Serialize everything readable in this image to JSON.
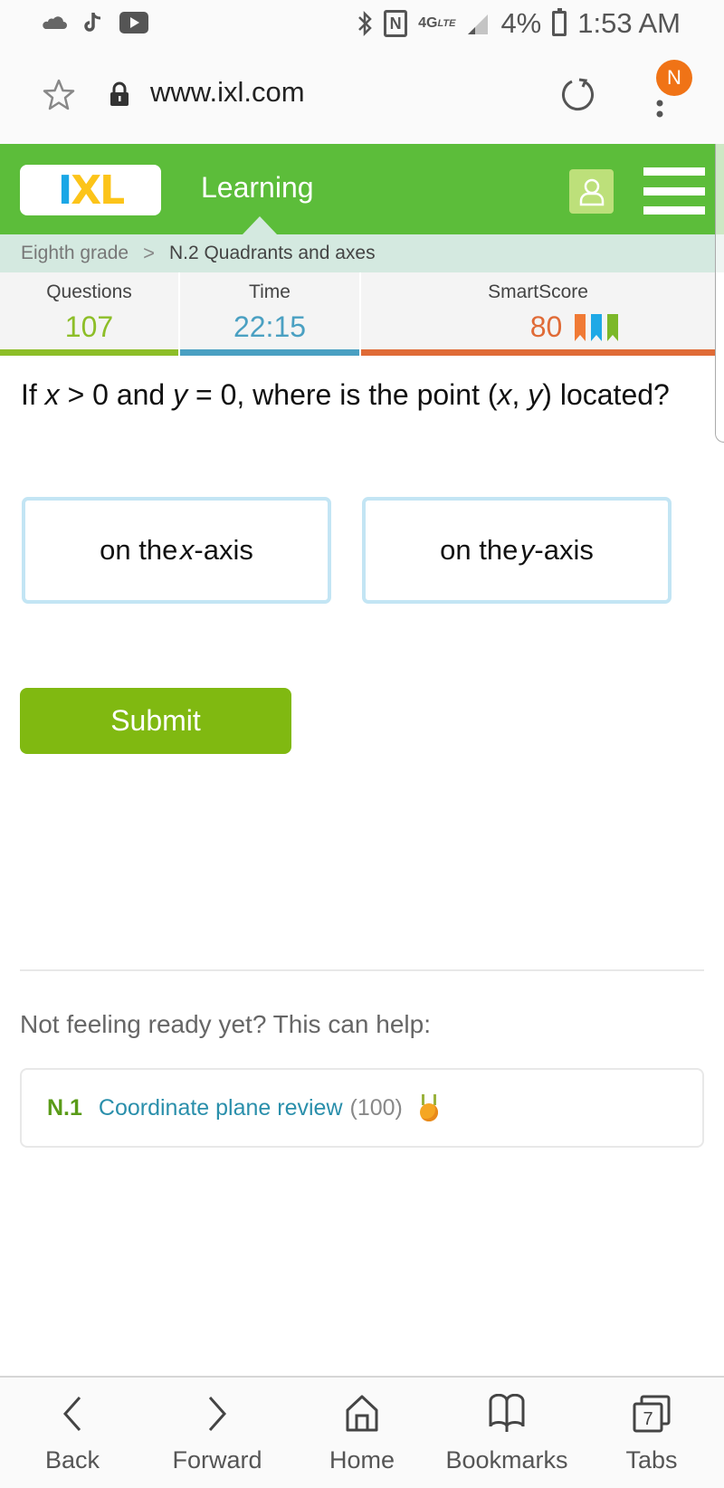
{
  "status_bar": {
    "left_icons": [
      "cloud-icon",
      "tiktok-icon",
      "youtube-icon"
    ],
    "right_icons": [
      "bluetooth-icon",
      "nfc-icon",
      "4g-lte-icon",
      "signal-icon"
    ],
    "network": "4G",
    "network_sub": "LTE",
    "nfc_label": "N",
    "battery": "4%",
    "time": "1:53 AM"
  },
  "browser": {
    "url": "www.ixl.com",
    "profile_initial": "N",
    "profile_color": "#f07316"
  },
  "header": {
    "logo_i": "I",
    "logo_xl": "XL",
    "nav_label": "Learning",
    "brand_color": "#5cbd3a"
  },
  "breadcrumb": {
    "items": [
      "Eighth grade",
      "N.2 Quadrants and axes"
    ],
    "separator": ">"
  },
  "stats": {
    "questions": {
      "label": "Questions",
      "value": "107",
      "color": "#8dbe28"
    },
    "time": {
      "label": "Time",
      "value": "22:15",
      "color": "#4aa0c2"
    },
    "smartscore": {
      "label": "SmartScore",
      "value": "80",
      "color": "#e06b37",
      "ribbon_colors": [
        "#f07a35",
        "#1fa9e6",
        "#7cb82a"
      ]
    }
  },
  "question": {
    "parts": [
      "If ",
      "x",
      " > 0 and ",
      "y",
      " = 0, where is the point (",
      "x",
      ", ",
      "y",
      ") located?"
    ]
  },
  "choices": [
    {
      "pre": "on the ",
      "var": "x",
      "post": "-axis"
    },
    {
      "pre": "on the ",
      "var": "y",
      "post": "-axis"
    }
  ],
  "submit_label": "Submit",
  "help": {
    "title": "Not feeling ready yet? This can help:",
    "items": [
      {
        "code": "N.1",
        "name": "Coordinate plane review",
        "score": "(100)",
        "icon": "medal-icon"
      }
    ]
  },
  "bottom_nav": [
    {
      "label": "Back",
      "icon": "chevron-left-icon"
    },
    {
      "label": "Forward",
      "icon": "chevron-right-icon"
    },
    {
      "label": "Home",
      "icon": "home-icon"
    },
    {
      "label": "Bookmarks",
      "icon": "bookmarks-icon"
    },
    {
      "label": "Tabs",
      "icon": "tabs-icon",
      "badge": "7"
    }
  ]
}
